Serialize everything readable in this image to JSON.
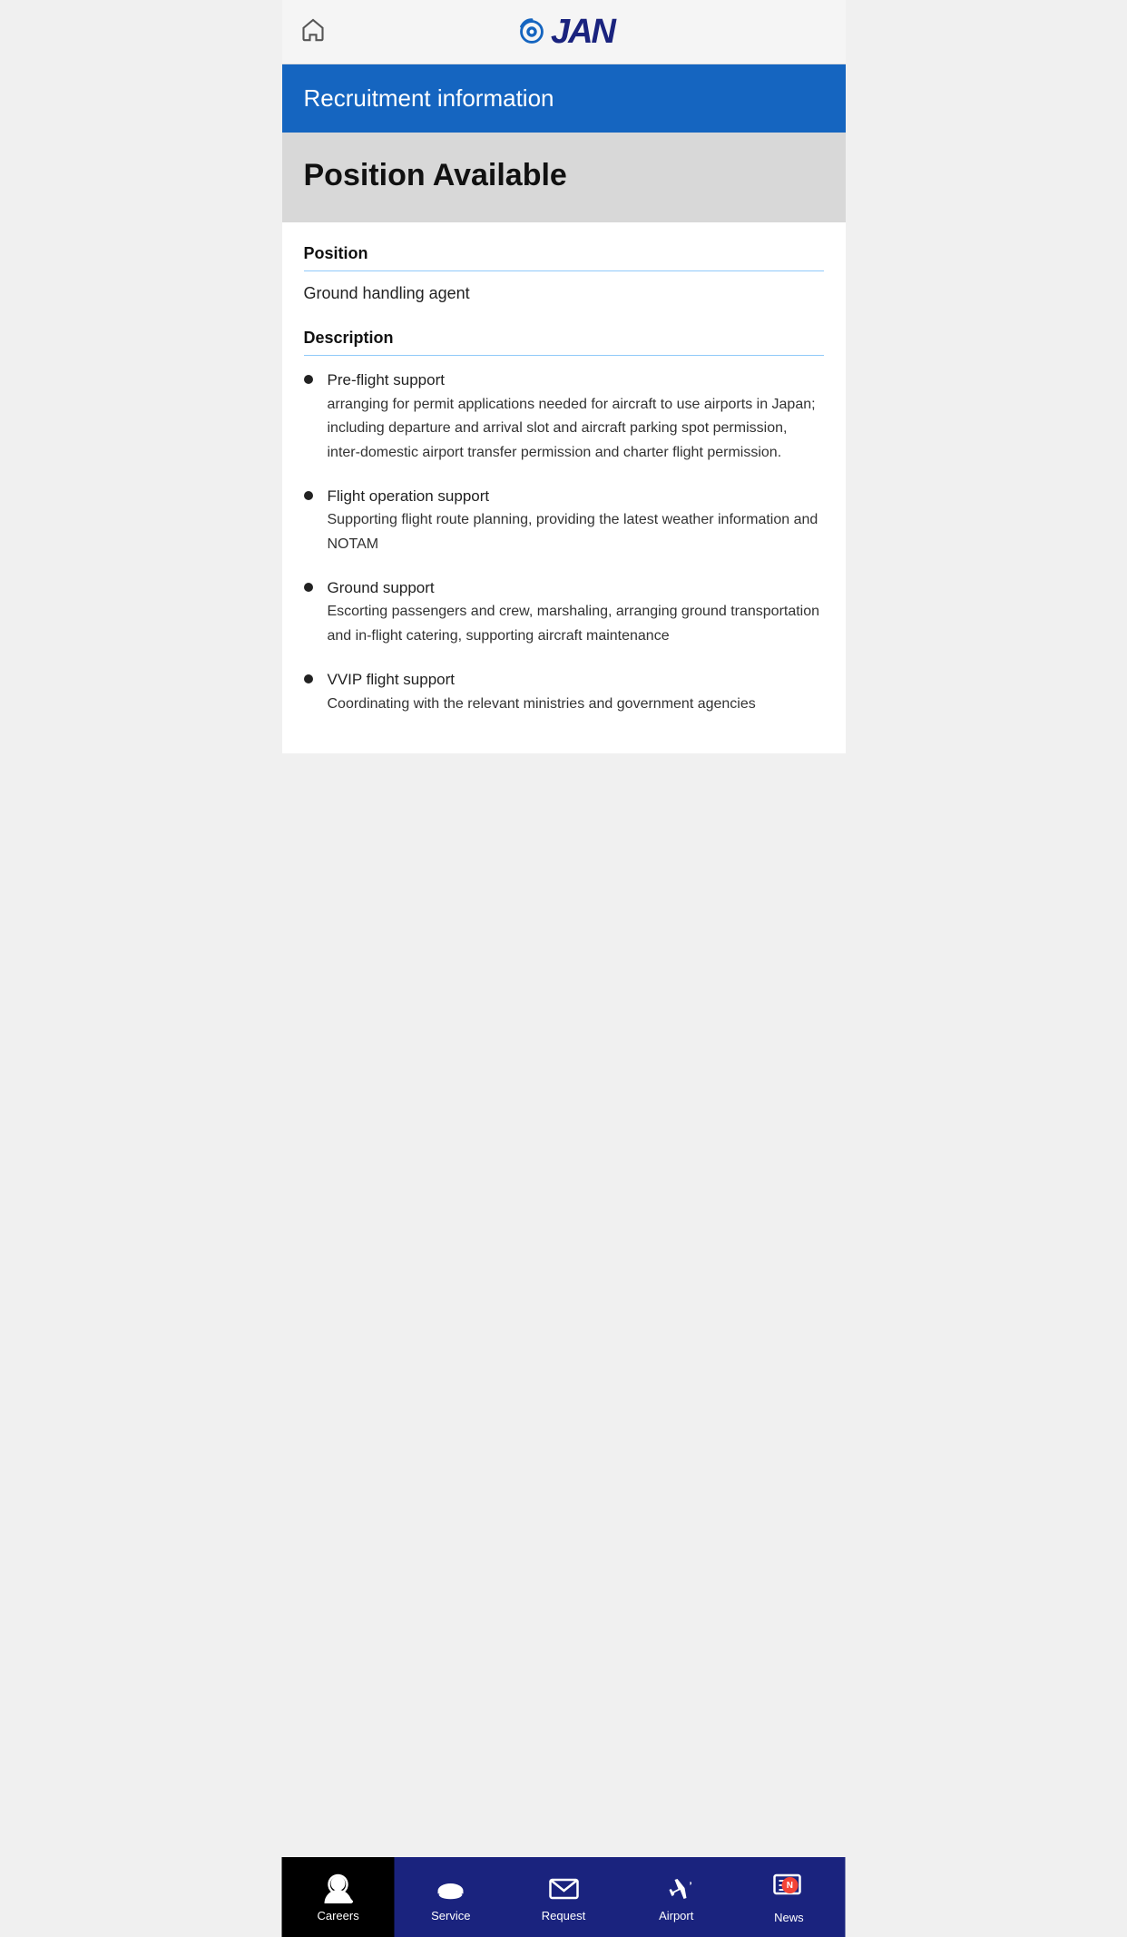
{
  "header": {
    "home_label": "Home",
    "logo_text": "JAN"
  },
  "banner": {
    "title": "Recruitment information"
  },
  "position_section": {
    "available_title": "Position Available",
    "position_label": "Position",
    "position_value": "Ground handling agent",
    "description_label": "Description",
    "bullets": [
      {
        "title": "Pre-flight support",
        "desc": "arranging for permit applications needed for aircraft to use airports in Japan; including departure and arrival slot and aircraft parking spot permission, inter-domestic airport transfer permission and charter flight permission."
      },
      {
        "title": "Flight operation support",
        "desc": "Supporting flight route planning, providing the latest weather information and NOTAM"
      },
      {
        "title": "Ground support",
        "desc": "Escorting passengers and crew, marshaling, arranging ground transportation and in-flight catering, supporting aircraft maintenance"
      },
      {
        "title": "VVIP flight support",
        "desc": "Coordinating with the relevant ministries and government agencies"
      }
    ]
  },
  "bottom_nav": {
    "items": [
      {
        "id": "careers",
        "label": "Careers",
        "active": true
      },
      {
        "id": "service",
        "label": "Service",
        "active": false
      },
      {
        "id": "request",
        "label": "Request",
        "active": false
      },
      {
        "id": "airport",
        "label": "Airport",
        "active": false
      },
      {
        "id": "news",
        "label": "News",
        "active": false,
        "badge": "N"
      }
    ]
  }
}
